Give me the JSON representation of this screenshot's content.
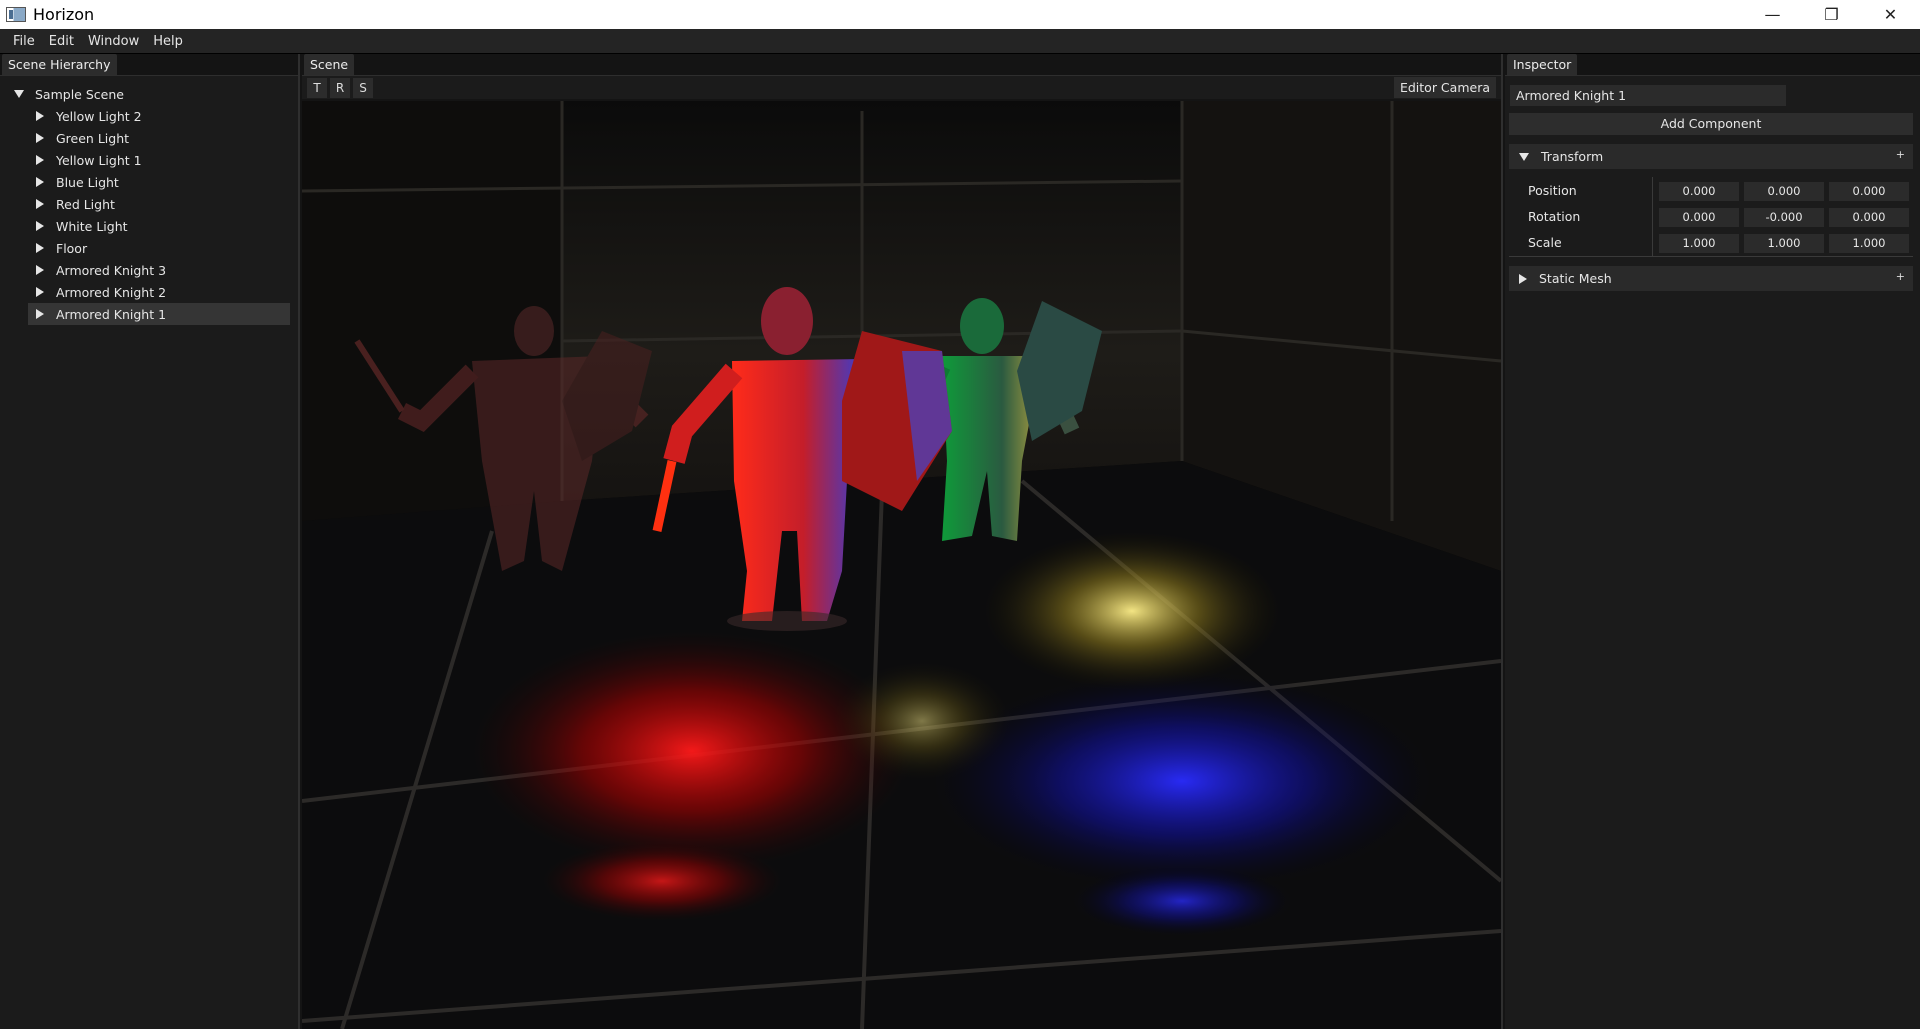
{
  "window": {
    "title": "Horizon",
    "icon": "app-icon",
    "controls": {
      "minimize": "—",
      "restore": "❐",
      "close": "✕"
    }
  },
  "menu": [
    "File",
    "Edit",
    "Window",
    "Help"
  ],
  "hierarchy": {
    "tab": "Scene Hierarchy",
    "root": "Sample Scene",
    "items": [
      "Yellow Light 2",
      "Green Light",
      "Yellow Light 1",
      "Blue Light",
      "Red Light",
      "White Light",
      "Floor",
      "Armored Knight 3",
      "Armored Knight 2",
      "Armored Knight 1"
    ],
    "selected": "Armored Knight 1"
  },
  "scene": {
    "tab": "Scene",
    "tools": [
      "T",
      "R",
      "S"
    ],
    "camera": "Editor Camera"
  },
  "inspector": {
    "tab": "Inspector",
    "object_name": "Armored Knight 1",
    "add_component": "Add Component",
    "transform": {
      "title": "Transform",
      "plus": "+",
      "position_label": "Position",
      "rotation_label": "Rotation",
      "scale_label": "Scale",
      "position": [
        "0.000",
        "0.000",
        "0.000"
      ],
      "rotation": [
        "0.000",
        "-0.000",
        "0.000"
      ],
      "scale": [
        "1.000",
        "1.000",
        "1.000"
      ]
    },
    "static_mesh": {
      "title": "Static Mesh",
      "plus": "+"
    }
  },
  "colors": {
    "background": "#1b1b1b",
    "panel_tab": "#2c2c2c",
    "selection": "#353535",
    "light_red": "#ff2020",
    "light_green": "#20ff60",
    "light_blue": "#2030ff",
    "light_yellow": "#ffe060"
  }
}
